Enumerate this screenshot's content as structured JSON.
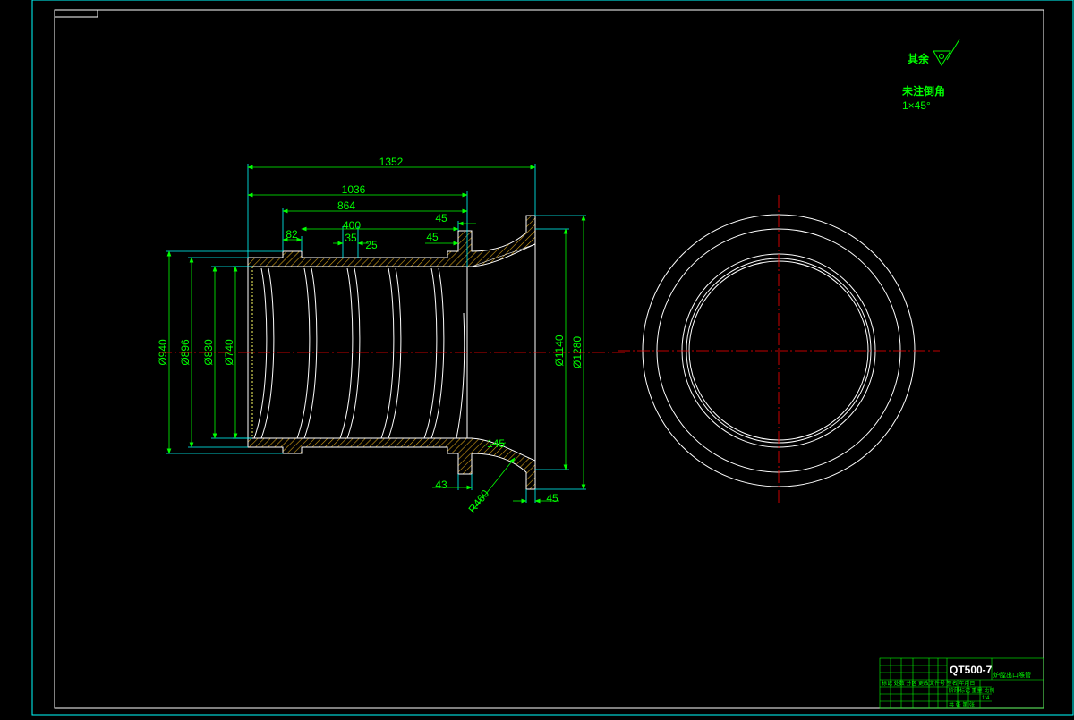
{
  "notes": {
    "remaining_label": "其余",
    "chamfer_label": "未注倒角",
    "chamfer_value": "1×45°"
  },
  "dimensions": {
    "len_1352": "1352",
    "len_1036": "1036",
    "len_864": "864",
    "len_400": "400",
    "len_45_top": "45",
    "len_82": "82",
    "len_35": "35",
    "len_25": "25",
    "len_45_flange": "45",
    "dia_940": "Ø940",
    "dia_896": "Ø896",
    "dia_830": "Ø830",
    "dia_740": "Ø740",
    "dia_1140": "Ø1140",
    "dia_1280": "Ø1280",
    "len_43": "43",
    "rad_460": "R460",
    "len_45_bottom": "45",
    "len_145": "145"
  },
  "title_block": {
    "material": "QT500-7",
    "part_name": "炉膛出口喉管",
    "row1": "标记 处数 分区 更改文件号 签名 年月日",
    "row2": "阶段标记 重量 比例",
    "ratio": "1:4",
    "row3": "共 张 第 张"
  },
  "colors": {
    "frame": "#ffffff",
    "border": "#00ffff",
    "section_outline": "#ffffff",
    "dimension": "#00ff00",
    "extension": "#00ffff",
    "hatch": "#d4a017",
    "centerline": "#ff0000"
  }
}
